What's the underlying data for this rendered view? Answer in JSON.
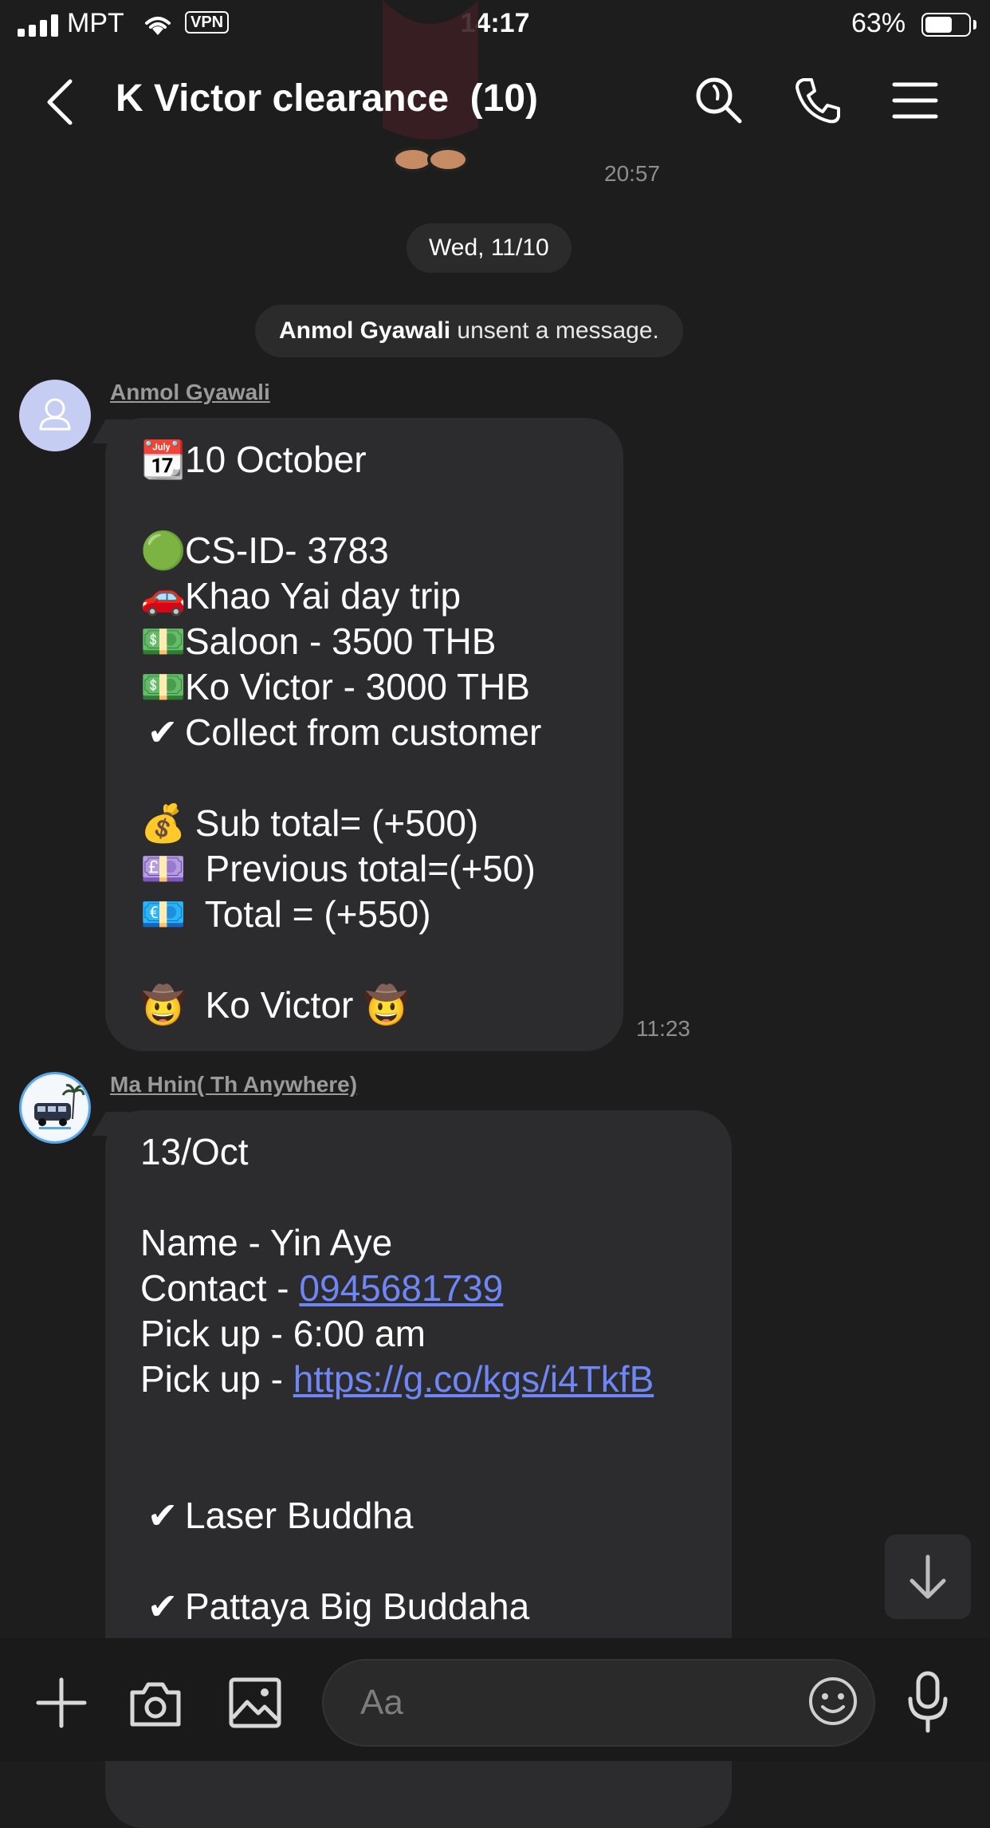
{
  "status_bar": {
    "carrier": "MPT",
    "vpn": "VPN",
    "time": "14:17",
    "battery_percent": "63%",
    "battery_level": 0.63
  },
  "header": {
    "title": "K Victor clearance  (10)",
    "back_icon": "chevron-left-icon",
    "search_icon": "search-icon",
    "call_icon": "phone-icon",
    "menu_icon": "menu-icon"
  },
  "chat": {
    "earlier_time": "20:57",
    "date_divider": "Wed, 11/10",
    "system_message": {
      "name": "Anmol Gyawali",
      "text": " unsent a message."
    },
    "messages": [
      {
        "sender": "Anmol Gyawali",
        "time": "11:23",
        "lines": [
          {
            "emoji": "📆",
            "text": "10 October"
          },
          {
            "emoji": "",
            "text": ""
          },
          {
            "emoji": "🟢",
            "text": "CS-ID- 3783"
          },
          {
            "emoji": "🚗",
            "text": "Khao Yai day trip"
          },
          {
            "emoji": "💵",
            "text": "Saloon - 3500 THB"
          },
          {
            "emoji": "💵",
            "text": "Ko Victor - 3000 THB"
          },
          {
            "emoji": "✔",
            "text": "Collect from customer"
          },
          {
            "emoji": "",
            "text": ""
          },
          {
            "emoji": "💰",
            "text": " Sub total= (+500)"
          },
          {
            "emoji": "💷",
            "text": "  Previous total=(+50)"
          },
          {
            "emoji": "💶",
            "text": "  Total = (+550)"
          },
          {
            "emoji": "",
            "text": ""
          },
          {
            "emoji": "🤠",
            "text": "  Ko Victor 🤠"
          }
        ]
      },
      {
        "sender": "Ma Hnin( Th Anywhere)",
        "lines": [
          {
            "text": "13/Oct"
          },
          {
            "text": ""
          },
          {
            "text": "Name - Yin Aye"
          },
          {
            "text": "Contact - ",
            "link": "0945681739"
          },
          {
            "text": "Pick up - 6:00 am"
          },
          {
            "text": "Pick up - ",
            "link": "https://g.co/kgs/i4TkfB"
          },
          {
            "text": ""
          },
          {
            "text": ""
          },
          {
            "emoji": "✔",
            "text": "Laser Buddha"
          },
          {
            "text": ""
          },
          {
            "emoji": "✔",
            "text": "Pattaya Big Buddaha"
          }
        ]
      }
    ]
  },
  "composer": {
    "placeholder": "Aa",
    "add_icon": "plus-icon",
    "camera_icon": "camera-icon",
    "gallery_icon": "image-icon",
    "emoji_icon": "smiley-icon",
    "mic_icon": "microphone-icon"
  },
  "scroll_down_icon": "arrow-down-icon"
}
